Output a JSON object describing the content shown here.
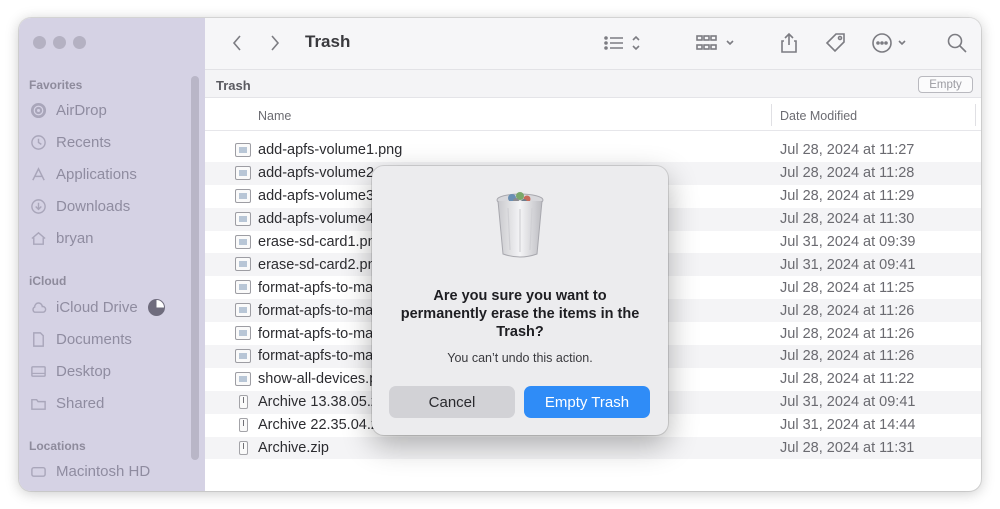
{
  "window": {
    "title": "Trash"
  },
  "sidebar": {
    "sections": [
      {
        "heading": "Favorites",
        "items": [
          {
            "label": "AirDrop",
            "icon": "airdrop-icon"
          },
          {
            "label": "Recents",
            "icon": "clock-icon"
          },
          {
            "label": "Applications",
            "icon": "applications-icon"
          },
          {
            "label": "Downloads",
            "icon": "download-icon"
          },
          {
            "label": "bryan",
            "icon": "home-icon"
          }
        ]
      },
      {
        "heading": "iCloud",
        "items": [
          {
            "label": "iCloud Drive",
            "icon": "cloud-icon"
          },
          {
            "label": "Documents",
            "icon": "document-icon"
          },
          {
            "label": "Desktop",
            "icon": "desktop-icon"
          },
          {
            "label": "Shared",
            "icon": "shared-folder-icon"
          }
        ]
      },
      {
        "heading": "Locations",
        "items": [
          {
            "label": "Macintosh HD",
            "icon": "disk-icon"
          }
        ]
      }
    ]
  },
  "pathbar": {
    "label": "Trash",
    "empty_button": "Empty"
  },
  "columns": {
    "name": "Name",
    "date": "Date Modified"
  },
  "files": [
    {
      "name": "add-apfs-volume1.png",
      "date": "Jul 28, 2024 at 11:27",
      "kind": "image"
    },
    {
      "name": "add-apfs-volume2.png",
      "date": "Jul 28, 2024 at 11:28",
      "kind": "image"
    },
    {
      "name": "add-apfs-volume3.png",
      "date": "Jul 28, 2024 at 11:29",
      "kind": "image"
    },
    {
      "name": "add-apfs-volume4.png",
      "date": "Jul 28, 2024 at 11:30",
      "kind": "image"
    },
    {
      "name": "erase-sd-card1.png",
      "date": "Jul 31, 2024 at 09:39",
      "kind": "image"
    },
    {
      "name": "erase-sd-card2.png",
      "date": "Jul 31, 2024 at 09:41",
      "kind": "image"
    },
    {
      "name": "format-apfs-to-mac1.png",
      "date": "Jul 28, 2024 at 11:25",
      "kind": "image"
    },
    {
      "name": "format-apfs-to-mac2.png",
      "date": "Jul 28, 2024 at 11:26",
      "kind": "image"
    },
    {
      "name": "format-apfs-to-mac3.png",
      "date": "Jul 28, 2024 at 11:26",
      "kind": "image"
    },
    {
      "name": "format-apfs-to-mac4.png",
      "date": "Jul 28, 2024 at 11:26",
      "kind": "image"
    },
    {
      "name": "show-all-devices.png",
      "date": "Jul 28, 2024 at 11:22",
      "kind": "image"
    },
    {
      "name": "Archive 13.38.05.zip",
      "date": "Jul 31, 2024 at 09:41",
      "kind": "zip"
    },
    {
      "name": "Archive 22.35.04.zip",
      "date": "Jul 31, 2024 at 14:44",
      "kind": "zip"
    },
    {
      "name": "Archive.zip",
      "date": "Jul 28, 2024 at 11:31",
      "kind": "zip"
    }
  ],
  "dialog": {
    "title": "Are you sure you want to permanently erase the items in the Trash?",
    "message": "You can’t undo this action.",
    "cancel_label": "Cancel",
    "confirm_label": "Empty Trash",
    "icon": "trash-can-icon"
  },
  "colors": {
    "accent": "#2f8cf7",
    "sidebar": "#d5d2e4"
  }
}
